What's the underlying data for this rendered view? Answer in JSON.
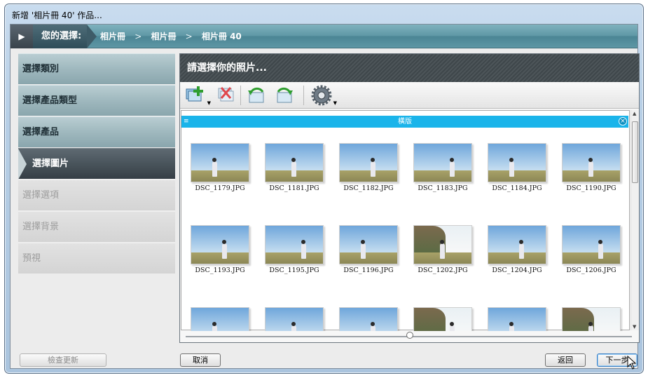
{
  "window": {
    "title": "新增 '相片冊 40' 作品..."
  },
  "breadcrumb": {
    "label": "您的選擇:",
    "crumbs": [
      "相片冊",
      ">",
      "相片冊",
      ">",
      "相片冊 40"
    ]
  },
  "nav": {
    "items": [
      {
        "label": "選擇類別",
        "state": "done"
      },
      {
        "label": "選擇產品類型",
        "state": "done"
      },
      {
        "label": "選擇產品",
        "state": "done"
      },
      {
        "label": "選擇圖片",
        "state": "active"
      },
      {
        "label": "選擇選項",
        "state": "disabled"
      },
      {
        "label": "選擇背景",
        "state": "disabled"
      },
      {
        "label": "預視",
        "state": "disabled"
      }
    ]
  },
  "panel": {
    "title": "請選擇你的照片...",
    "toolbar": [
      {
        "icon": "add-photos-icon",
        "dropdown": true
      },
      {
        "icon": "remove-photo-icon",
        "dropdown": false
      },
      {
        "icon": "rotate-left-icon",
        "dropdown": false
      },
      {
        "icon": "rotate-right-icon",
        "dropdown": false
      },
      {
        "icon": "settings-gear-icon",
        "dropdown": true
      }
    ],
    "group": {
      "title": "橫版",
      "close": "×",
      "collapse": "≡"
    },
    "photos": [
      "DSC_1179.JPG",
      "DSC_1181.JPG",
      "DSC_1182.JPG",
      "DSC_1183.JPG",
      "DSC_1184.JPG",
      "DSC_1190.JPG",
      "DSC_1193.JPG",
      "DSC_1195.JPG",
      "DSC_1196.JPG",
      "DSC_1202.JPG",
      "DSC_1204.JPG",
      "DSC_1206.JPG",
      "",
      "",
      "",
      "",
      "",
      ""
    ],
    "thumbnail_size": 0.5
  },
  "buttons": {
    "check_update": "檢查更新",
    "cancel": "取消",
    "back": "返回",
    "next": "下一步"
  },
  "colors": {
    "group_bar": "#1ab4ea",
    "breadcrumb": "#5f98a6",
    "nav_active": "#353e45"
  }
}
